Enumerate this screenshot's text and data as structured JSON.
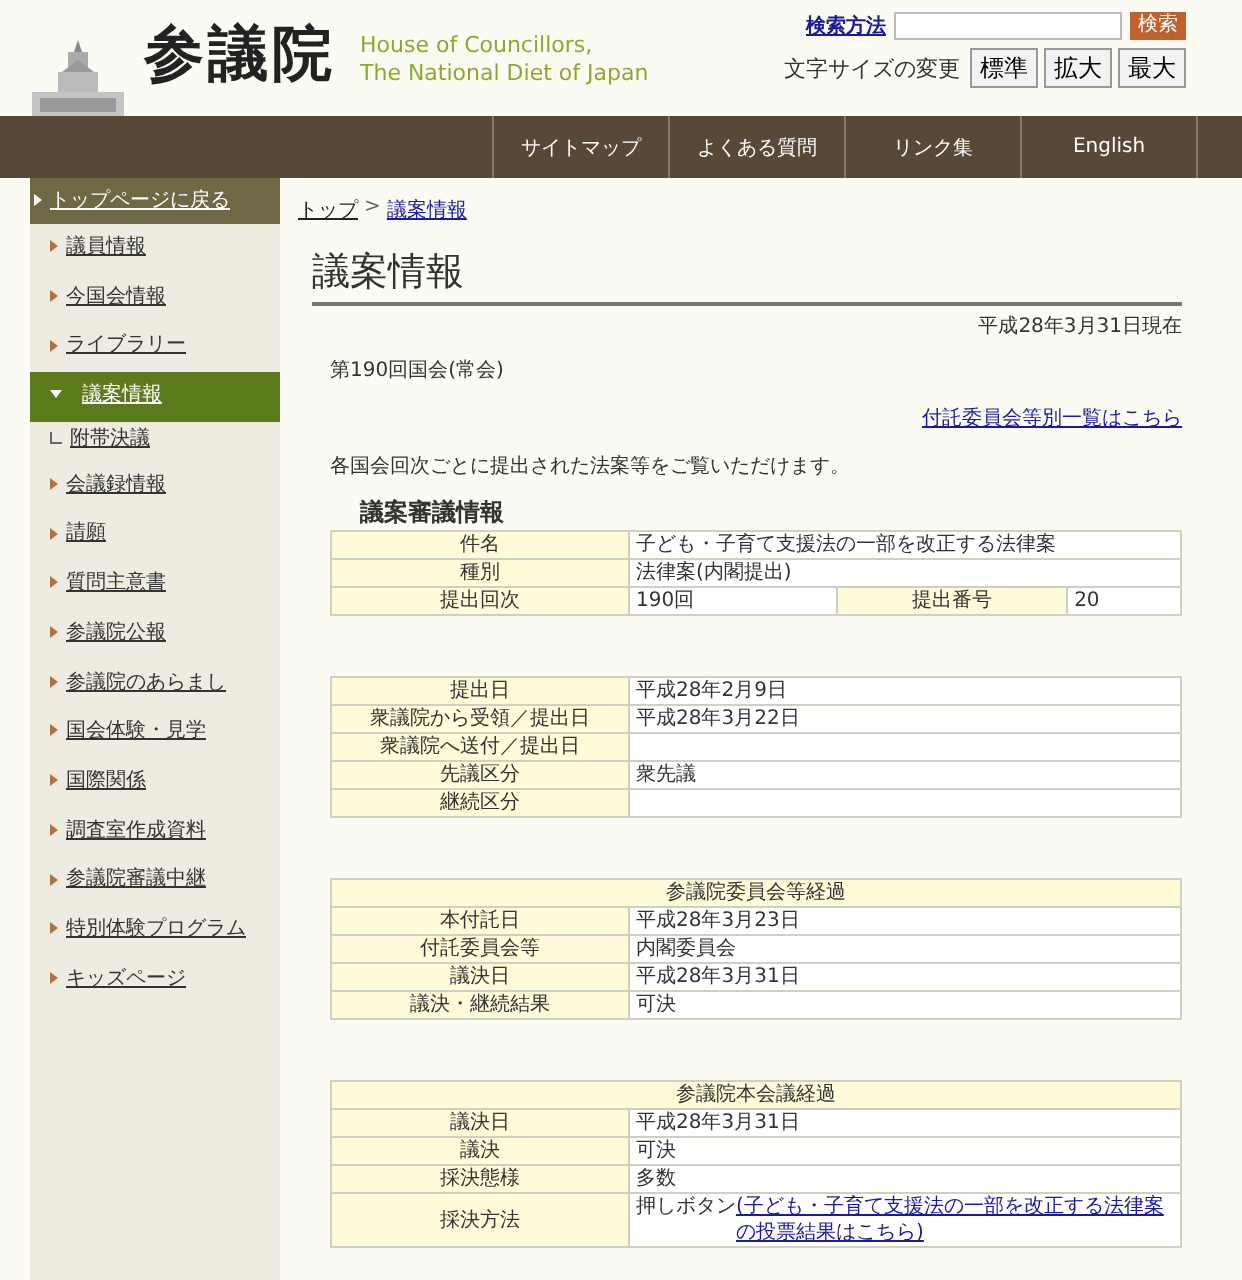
{
  "header": {
    "site_name": "参議院",
    "english_name": [
      "House of Councillors,",
      "The National Diet of Japan"
    ],
    "search_help": "検索方法",
    "search_button": "検索",
    "font_size_label": "文字サイズの変更",
    "font_sizes": [
      {
        "label": "標準"
      },
      {
        "label": "拡大"
      },
      {
        "label": "最大"
      }
    ]
  },
  "nav": [
    "サイトマップ",
    "よくある質問",
    "リンク集",
    "English"
  ],
  "sidebar": {
    "back": "トップページに戻る",
    "items": [
      {
        "label": "議員情報",
        "selected": false
      },
      {
        "label": "今国会情報",
        "selected": false
      },
      {
        "label": "ライブラリー",
        "selected": false
      },
      {
        "label": "議案情報",
        "selected": true,
        "children": [
          {
            "label": "附帯決議"
          }
        ]
      },
      {
        "label": "会議録情報",
        "selected": false
      },
      {
        "label": "請願",
        "selected": false
      },
      {
        "label": "質問主意書",
        "selected": false
      },
      {
        "label": "参議院公報",
        "selected": false
      },
      {
        "label": "参議院のあらまし",
        "selected": false
      },
      {
        "label": "国会体験・見学",
        "selected": false
      },
      {
        "label": "国際関係",
        "selected": false
      },
      {
        "label": "調査室作成資料",
        "selected": false
      },
      {
        "label": "参議院審議中継",
        "selected": false
      },
      {
        "label": "特別体験プログラム",
        "selected": false
      },
      {
        "label": "キッズページ",
        "selected": false
      }
    ]
  },
  "breadcrumb": [
    {
      "label": "トップ"
    },
    {
      "label": "議案情報"
    }
  ],
  "breadcrumb_separator": ">",
  "page_title": "議案情報",
  "as_of": "平成28年3月31日現在",
  "session": "第190回国会(常会)",
  "committee_link": "付託委員会等別一覧はこちら",
  "intro": "各国会回次ごとに提出された法案等をご覧いただけます。",
  "section_title": "議案審議情報",
  "tables": [
    {
      "rows": [
        {
          "label": "件名",
          "value": "子ども・子育て支援法の一部を改正する法律案"
        },
        {
          "label": "種別",
          "value": "法律案(内閣提出)"
        },
        {
          "label": "提出回次",
          "value": "190回",
          "label_2": "提出番号",
          "value_2": "20"
        }
      ]
    },
    {
      "rows": [
        {
          "label": "提出日",
          "value": "平成28年2月9日"
        },
        {
          "label": "衆議院から受領／提出日",
          "value": "平成28年3月22日"
        },
        {
          "label": "衆議院へ送付／提出日"
        },
        {
          "label": "先議区分",
          "value": "衆先議"
        },
        {
          "label": "継続区分"
        }
      ]
    },
    {
      "heading": "参議院委員会等経過",
      "rows": [
        {
          "label": "本付託日",
          "value": "平成28年3月23日"
        },
        {
          "label": "付託委員会等",
          "value": "内閣委員会"
        },
        {
          "label": "議決日",
          "value": "平成28年3月31日"
        },
        {
          "label": "議決・継続結果",
          "value": "可決"
        }
      ]
    },
    {
      "heading": "参議院本会議経過",
      "rows": [
        {
          "label": "議決日",
          "value": "平成28年3月31日"
        },
        {
          "label": "議決",
          "value": "可決"
        },
        {
          "label": "採決態様",
          "value": "多数"
        },
        {
          "label": "採決方法",
          "value": "押しボタン",
          "link": "(子ども・子育て支援法の一部を改正する法律案の投票結果はこちら)"
        }
      ]
    }
  ]
}
